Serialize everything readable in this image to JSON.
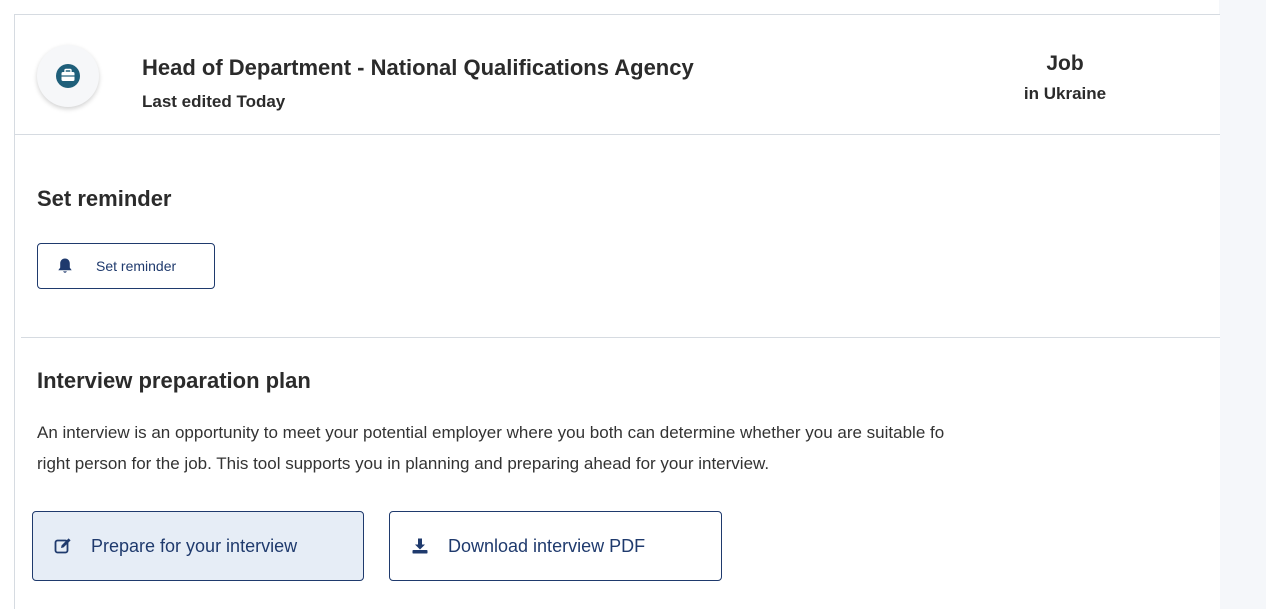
{
  "header": {
    "title": "Head of Department - National Qualifications Agency",
    "subtitle": "Last edited Today",
    "type_label": "Job",
    "location_label": "in Ukraine",
    "avatar_icon": "briefcase-icon"
  },
  "reminder_section": {
    "title": "Set reminder",
    "button_label": "Set reminder",
    "button_icon": "bell-icon"
  },
  "interview_section": {
    "title": "Interview preparation plan",
    "description_line1": "An interview is an opportunity to meet your potential employer where you both can determine whether you are suitable fo",
    "description_line2": "right person for the job. This tool supports you in planning and preparing ahead for your interview.",
    "prepare_button_label": "Prepare for your interview",
    "prepare_button_icon": "edit-icon",
    "download_button_label": "Download interview PDF",
    "download_button_icon": "download-icon"
  },
  "colors": {
    "accent": "#1f3a6d",
    "prepare_button_bg": "#e6edf6",
    "avatar_icon_color": "#1f5f7a"
  }
}
